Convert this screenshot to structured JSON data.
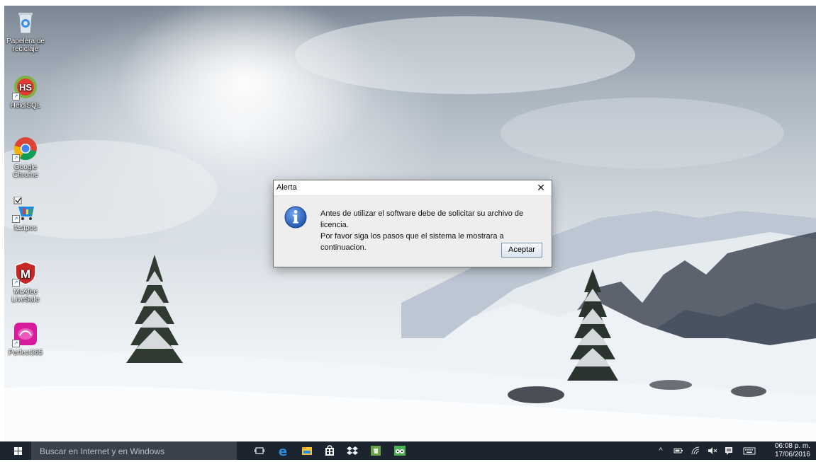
{
  "desktop_icons": [
    {
      "label": "Papelera de reciclaje",
      "icon": "recycle-bin-icon"
    },
    {
      "label": "HeidiSQL",
      "icon": "heidisql-icon"
    },
    {
      "label": "Google Chrome",
      "icon": "chrome-icon"
    },
    {
      "label": "fastpos",
      "icon": "fastpos-icon"
    },
    {
      "label": "McAfee LiveSafe",
      "icon": "mcafee-icon"
    },
    {
      "label": "Perfect365",
      "icon": "perfect365-icon"
    }
  ],
  "dialog": {
    "title": "Alerta",
    "close_label": "✕",
    "message_line1": "Antes de utilizar el software debe de solicitar su archivo de licencia.",
    "message_line2": "Por favor siga los pasos que el sistema le mostrara a continuacion.",
    "ok_label": "Aceptar",
    "icon": "info-icon"
  },
  "taskbar": {
    "search_placeholder": "Buscar en Internet y en Windows",
    "pinned": [
      "task-view-icon",
      "edge-icon",
      "file-explorer-icon",
      "store-icon",
      "dropbox-icon",
      "evernote-icon",
      "tripadvisor-icon"
    ],
    "tray": [
      "chevron-up-icon",
      "battery-icon",
      "wifi-icon",
      "volume-icon",
      "notifications-icon",
      "keyboard-icon"
    ],
    "time": "06:08 p. m.",
    "date": "17/06/2016"
  },
  "colors": {
    "taskbar": "#1c2430",
    "search_box": "#3a414b",
    "dialog_bg": "#eeeeee",
    "info_blue": "#2f6fcf"
  }
}
